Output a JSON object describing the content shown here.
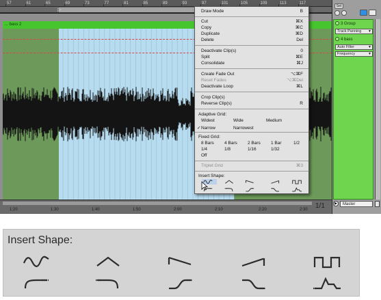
{
  "ruler": {
    "bars": [
      "57",
      "61",
      "65",
      "69",
      "73",
      "77",
      "81",
      "85",
      "89",
      "93",
      "97",
      "101",
      "105",
      "109",
      "113",
      "117"
    ]
  },
  "clip": {
    "name": "... bass 2"
  },
  "timeline": {
    "labels": [
      "1:20",
      "1:30",
      "1:40",
      "1:50",
      "2:00",
      "2:10",
      "2:20",
      "2:30"
    ],
    "page_indicator": "1/1"
  },
  "mixer": {
    "set_label": "Set",
    "group_title": "3 Group",
    "group_select": "Track Panning",
    "track_title": "4 bass",
    "device_select": "Auto Filter",
    "param_select": "Frequency",
    "master_label": "Master",
    "master_btn": "▶"
  },
  "menu": {
    "items": [
      {
        "label": "Draw Mode",
        "shortcut": "B",
        "disabled": false
      },
      {
        "label": "Cut",
        "shortcut": "⌘X",
        "disabled": false
      },
      {
        "label": "Copy",
        "shortcut": "⌘C",
        "disabled": false
      },
      {
        "label": "Duplicate",
        "shortcut": "⌘D",
        "disabled": false
      },
      {
        "label": "Delete",
        "shortcut": "Del",
        "disabled": false
      },
      {
        "label": "Deactivate Clip(s)",
        "shortcut": "0",
        "disabled": false
      },
      {
        "label": "Split",
        "shortcut": "⌘E",
        "disabled": false
      },
      {
        "label": "Consolidate",
        "shortcut": "⌘J",
        "disabled": false
      },
      {
        "label": "Create Fade Out",
        "shortcut": "⌥⌘F",
        "disabled": false
      },
      {
        "label": "Reset Fades",
        "shortcut": "⌥⌘Del",
        "disabled": true
      },
      {
        "label": "Deactivate Loop",
        "shortcut": "⌘L",
        "disabled": false
      },
      {
        "label": "Crop Clip(s)",
        "shortcut": "",
        "disabled": false
      },
      {
        "label": "Reverse Clip(s)",
        "shortcut": "R",
        "disabled": false
      },
      {
        "label": "Triplet Grid",
        "shortcut": "⌘3",
        "disabled": true
      }
    ],
    "adaptive_grid_heading": "Adaptive Grid:",
    "adaptive_grid": [
      "Widest",
      "Wide",
      "Medium",
      "Narrow",
      "Narrowest"
    ],
    "adaptive_selected": "Narrow",
    "checkmark": "✓",
    "fixed_grid_heading": "Fixed Grid:",
    "fixed_grid": [
      "8 Bars",
      "4 Bars",
      "2 Bars",
      "1 Bar",
      "1/2",
      "1/4",
      "1/8",
      "1/16",
      "1/32",
      "Off"
    ],
    "insert_shape_heading": "Insert Shape:",
    "shapes": [
      "sine",
      "triangle",
      "saw-down",
      "saw-up",
      "square",
      "ramp-in",
      "ramp-out",
      "s-curve-up",
      "s-curve-down",
      "adsr"
    ]
  },
  "zoom": {
    "heading": "Insert Shape:"
  },
  "colors": {
    "clip_green": "#46c52f",
    "selection_blue": "#b8dcef",
    "menu_bg": "#e2e2e2"
  }
}
